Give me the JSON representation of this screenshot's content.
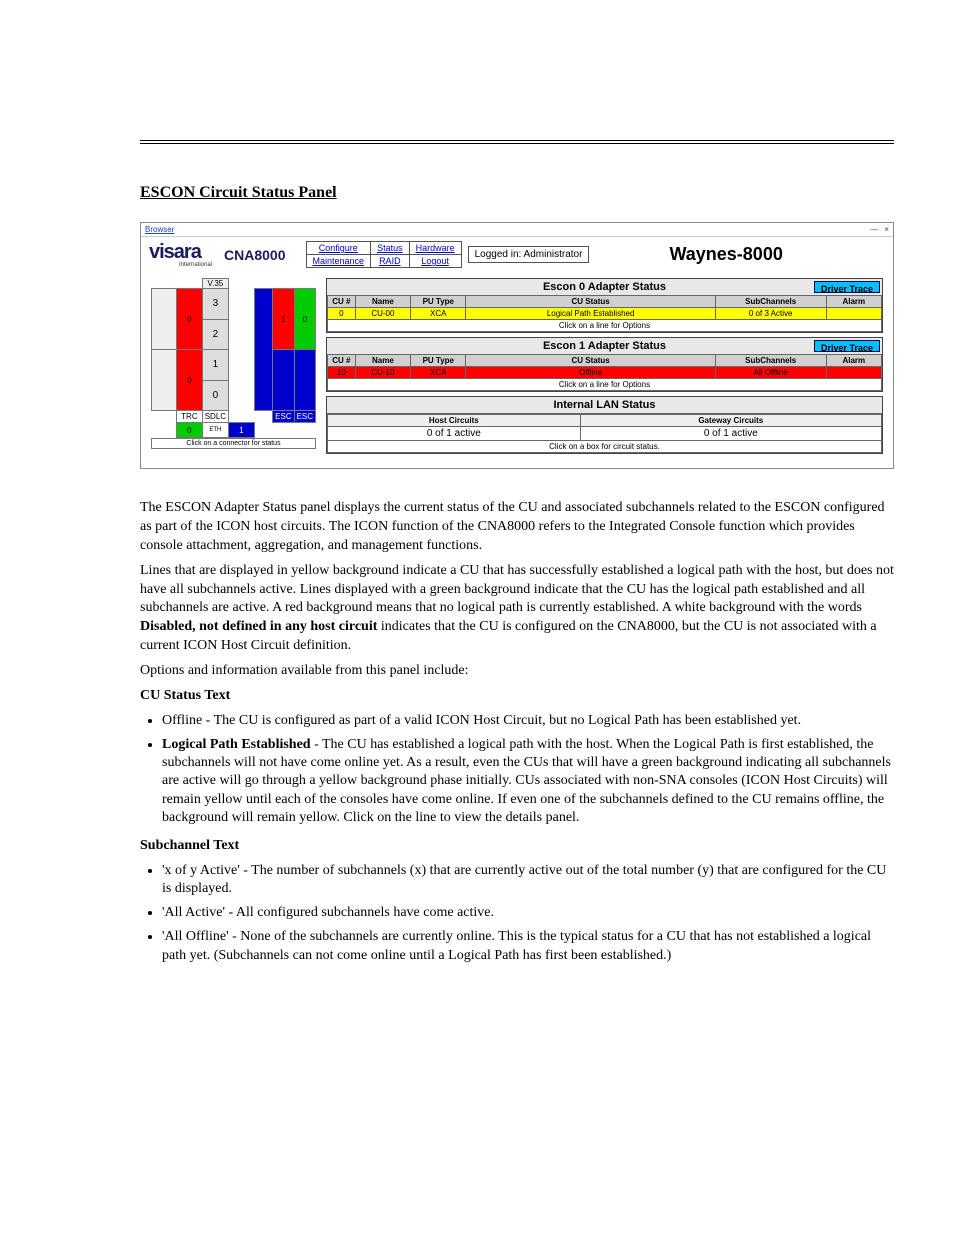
{
  "section": {
    "title": "ESCON Circuit Status Panel"
  },
  "browser": {
    "title_hint": "Browser",
    "btn1": "—",
    "btn2": "×"
  },
  "header": {
    "logo": "visara",
    "logo_sub": "International",
    "product": "CNA8000",
    "nav": {
      "r1c1": "Configure",
      "r1c2": "Status",
      "r1c3": "Hardware",
      "r2c1": "Maintenance",
      "r2c2": "RAID",
      "r2c3": "Logout"
    },
    "logged_in": "Logged in: Administrator",
    "hostname": "Waynes-8000"
  },
  "left": {
    "v35": "V.35",
    "slots": [
      "3",
      "2",
      "1",
      "0"
    ],
    "red0": "0",
    "red1": "0",
    "slot1": "1",
    "slot0": "0",
    "trc": "TRC",
    "sdlc": "SDLC",
    "esc": "ESC",
    "eth": "ETH",
    "click": "Click on a connector for status"
  },
  "escon0": {
    "title": "Escon 0 Adapter Status",
    "trace": "Driver Trace",
    "cols": {
      "cu": "CU #",
      "name": "Name",
      "pu": "PU Type",
      "stat": "CU Status",
      "sub": "SubChannels",
      "alarm": "Alarm"
    },
    "row": {
      "cu": "0",
      "name": "CU-00",
      "pu": "XCA",
      "stat": "Logical Path Established",
      "sub": "0 of 3 Active",
      "alarm": ""
    },
    "opt": "Click on a line for Options"
  },
  "escon1": {
    "title": "Escon 1 Adapter Status",
    "trace": "Driver Trace",
    "cols": {
      "cu": "CU #",
      "name": "Name",
      "pu": "PU Type",
      "stat": "CU Status",
      "sub": "SubChannels",
      "alarm": "Alarm"
    },
    "row": {
      "cu": "10",
      "name": "CU-10",
      "pu": "XCA",
      "stat": "Offline",
      "sub": "All Offline",
      "alarm": ""
    },
    "opt": "Click on a line for Options"
  },
  "lan": {
    "title": "Internal LAN Status",
    "hosth": "Host Circuits",
    "gwh": "Gateway Circuits",
    "hostv": "0 of 1 active",
    "gwv": "0 of 1 active",
    "foot": "Click on a box for circuit status."
  },
  "text": {
    "p1": "The ESCON Adapter Status panel displays the current status of the CU and associated subchannels related to the ESCON configured as part of the ICON host circuits. The ICON function of the CNA8000 refers to the Integrated Console function which provides console attachment, aggregation, and management functions.",
    "p2a": "Lines that are displayed in yellow background indicate a CU that has successfully established a logical path with the host, but does not have all subchannels active. Lines displayed with a green background indicate that the CU has the logical path established and all subchannels are active. A red background means that no logical path is currently established. A white background with the words ",
    "p2b": "Disabled, not defined in any host circuit",
    "p2c": " indicates that the CU is configured on the CNA8000, but the CU is not associated with a current ICON Host Circuit definition.",
    "p3": "Options and information available from this panel include:",
    "p4head": "CU Status Text",
    "li1": "Offline - The CU is configured as part of a valid ICON Host Circuit, but no Logical Path has been established yet.",
    "li2head": "Logical Path Established",
    "li2body": " - The CU has established a logical path with the host. When the Logical Path is first established, the subchannels will not have come online yet. As a result, even the CUs that will have a green background indicating all subchannels are active will go through a yellow background phase initially. CUs associated with non-SNA consoles (ICON Host Circuits) will remain yellow until each of the consoles have come online. If even one of the subchannels defined to the CU remains offline, the background will remain yellow. Click on the line to view the details panel.",
    "h_subch": "Subchannel Text",
    "li_s1": "'x of y Active' - The number of subchannels (x) that are currently active out of the total number (y) that are configured for the CU is displayed.",
    "li_s2": "'All Active' - All configured subchannels have come active.",
    "li_s3": "'All Offline' - None of the subchannels are currently online. This is the typical status for a CU that has not established a logical path yet. (Subchannels can not come online until a Logical Path has first been established.)"
  }
}
